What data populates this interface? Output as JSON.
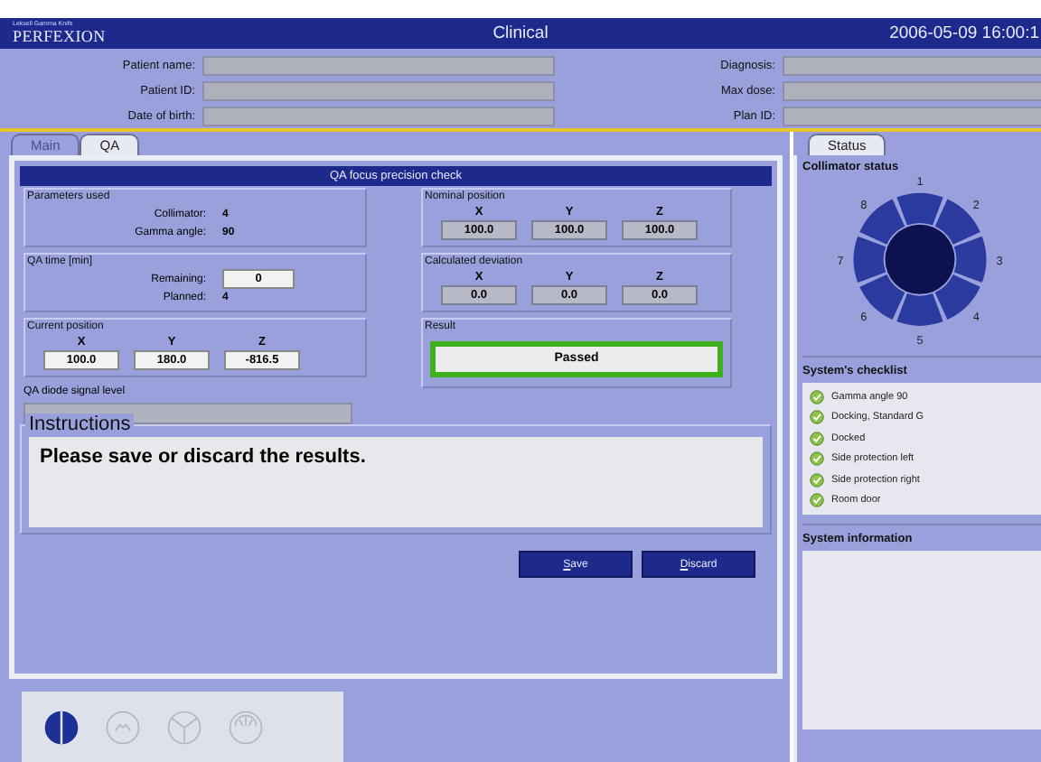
{
  "header": {
    "logo_small": "Leksell Gamma Knife",
    "logo": "PERFEXION",
    "title": "Clinical",
    "datetime": "2006-05-09 16:00:1"
  },
  "patient_left": [
    {
      "label": "Patient name:"
    },
    {
      "label": "Patient ID:"
    },
    {
      "label": "Date of birth:"
    }
  ],
  "patient_right": [
    {
      "label": "Diagnosis:"
    },
    {
      "label": "Max dose:"
    },
    {
      "label": "Plan ID:"
    }
  ],
  "tabs": [
    {
      "label": "Main",
      "selected": false
    },
    {
      "label": "QA",
      "selected": true
    }
  ],
  "qa": {
    "title": "QA focus precision check",
    "parameters": {
      "title": "Parameters used",
      "rows": [
        {
          "label": "Collimator:",
          "value": "4"
        },
        {
          "label": "Gamma angle:",
          "value": "90"
        }
      ]
    },
    "qa_time": {
      "title": "QA time [min]",
      "remaining_label": "Remaining:",
      "remaining": "0",
      "planned_label": "Planned:",
      "planned": "4"
    },
    "current_position": {
      "title": "Current position",
      "axes": [
        "X",
        "Y",
        "Z"
      ],
      "values": [
        "100.0",
        "180.0",
        "-816.5"
      ]
    },
    "diode": {
      "title": "QA diode signal level"
    },
    "nominal_position": {
      "title": "Nominal position",
      "axes": [
        "X",
        "Y",
        "Z"
      ],
      "values": [
        "100.0",
        "100.0",
        "100.0"
      ]
    },
    "calculated_deviation": {
      "title": "Calculated deviation",
      "axes": [
        "X",
        "Y",
        "Z"
      ],
      "values": [
        "0.0",
        "0.0",
        "0.0"
      ]
    },
    "result": {
      "title": "Result",
      "value": "Passed",
      "passed": true
    },
    "instructions": {
      "title": "Instructions",
      "text": "Please save or discard the results."
    },
    "buttons": [
      "Save",
      "Discard"
    ]
  },
  "bottom_tools": [
    {
      "selected": true
    },
    {
      "selected": false
    },
    {
      "selected": false
    },
    {
      "selected": false
    }
  ],
  "status": {
    "tab": "Status",
    "collimator_title": "Collimator status",
    "sectors": [
      "1",
      "2",
      "3",
      "4",
      "5",
      "6",
      "7",
      "8"
    ],
    "checklist_title": "System's checklist",
    "checklist": [
      {
        "label": "Gamma angle 90",
        "checked": true
      },
      {
        "label": "Docking, Standard G",
        "checked": true
      },
      {
        "label": "Docked",
        "checked": true
      },
      {
        "label": "Side protection left",
        "checked": true
      },
      {
        "label": "Side protection right",
        "checked": true
      },
      {
        "label": "Room door",
        "checked": true
      }
    ],
    "info_title": "System information"
  }
}
